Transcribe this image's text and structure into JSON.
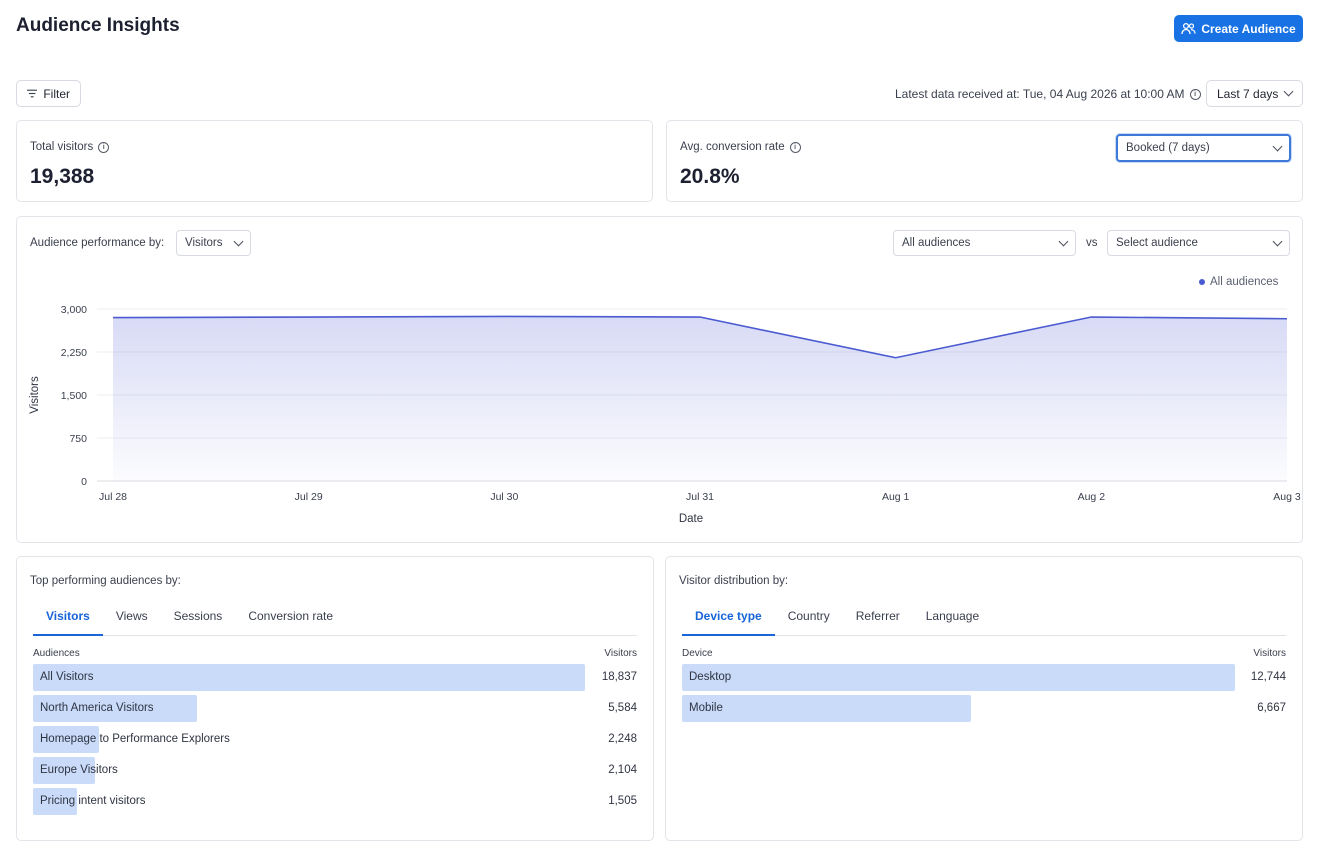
{
  "header": {
    "title": "Audience Insights",
    "create_label": "Create Audience"
  },
  "toolbar": {
    "filter_label": "Filter",
    "latest_text": "Latest data received at: Tue, 04 Aug 2026 at 10:00 AM",
    "range_label": "Last 7 days"
  },
  "kpis": {
    "total_visitors": {
      "label": "Total visitors",
      "value": "19,388"
    },
    "conversion": {
      "label": "Avg. conversion rate",
      "value": "20.8%",
      "select_value": "Booked (7 days)"
    }
  },
  "performance": {
    "label": "Audience performance by:",
    "metric_select": "Visitors",
    "audience_select": "All audiences",
    "vs_label": "vs",
    "compare_placeholder": "Select audience"
  },
  "chart_data": {
    "type": "area",
    "x": [
      "Jul 28",
      "Jul 29",
      "Jul 30",
      "Jul 31",
      "Aug 1",
      "Aug 2",
      "Aug 3"
    ],
    "series": [
      {
        "name": "All audiences",
        "values": [
          2850,
          2860,
          2870,
          2860,
          2150,
          2860,
          2830
        ]
      }
    ],
    "xlabel": "Date",
    "ylabel": "Visitors",
    "ylim": [
      0,
      3000
    ],
    "yticks": [
      "0",
      "750",
      "1,500",
      "2,250",
      "3,000"
    ],
    "legend_position": "top-right",
    "grid": true,
    "color": "#4a5ad0"
  },
  "top_audiences": {
    "label": "Top performing audiences by:",
    "tabs": [
      "Visitors",
      "Views",
      "Sessions",
      "Conversion rate"
    ],
    "active_tab": 0,
    "col_left": "Audiences",
    "col_right": "Visitors",
    "max": 18837,
    "rows": [
      {
        "label": "All Visitors",
        "value": "18,837",
        "n": 18837
      },
      {
        "label": "North America Visitors",
        "value": "5,584",
        "n": 5584
      },
      {
        "label": "Homepage to Performance Explorers",
        "value": "2,248",
        "n": 2248
      },
      {
        "label": "Europe Visitors",
        "value": "2,104",
        "n": 2104
      },
      {
        "label": "Pricing intent visitors",
        "value": "1,505",
        "n": 1505
      }
    ]
  },
  "distribution": {
    "label": "Visitor distribution by:",
    "tabs": [
      "Device type",
      "Country",
      "Referrer",
      "Language"
    ],
    "active_tab": 0,
    "col_left": "Device",
    "col_right": "Visitors",
    "max": 12744,
    "rows": [
      {
        "label": "Desktop",
        "value": "12,744",
        "n": 12744
      },
      {
        "label": "Mobile",
        "value": "6,667",
        "n": 6667
      }
    ]
  },
  "colors": {
    "accent": "#1872e3",
    "line": "#4a5ad0",
    "bar": "#c9dbf8"
  }
}
